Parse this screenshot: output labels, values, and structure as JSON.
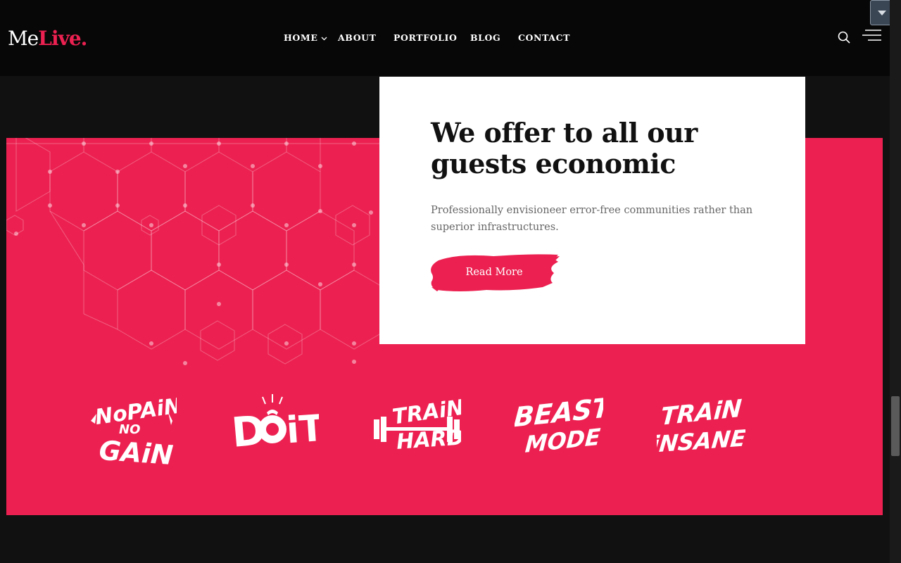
{
  "header": {
    "logo_prefix": "Me",
    "logo_accent": "Live.",
    "nav": [
      {
        "label": "HOME"
      },
      {
        "label": "ABOUT"
      },
      {
        "label": "PORTFOLIO"
      },
      {
        "label": "BLOG"
      },
      {
        "label": "CONTACT"
      }
    ]
  },
  "card": {
    "title": "We offer to all our guests economic",
    "text": "Professionally envisioneer error-free communities rather than superior infrastructures.",
    "button_label": "Read More"
  },
  "brands": [
    "NO PAIN NO GAIN",
    "DO IT",
    "TRAIN HARD",
    "BEAST MODE",
    "TRAIN INSANE"
  ],
  "colors": {
    "accent": "#ec2151",
    "background": "#111111",
    "header": "#070707",
    "card": "#ffffff"
  }
}
